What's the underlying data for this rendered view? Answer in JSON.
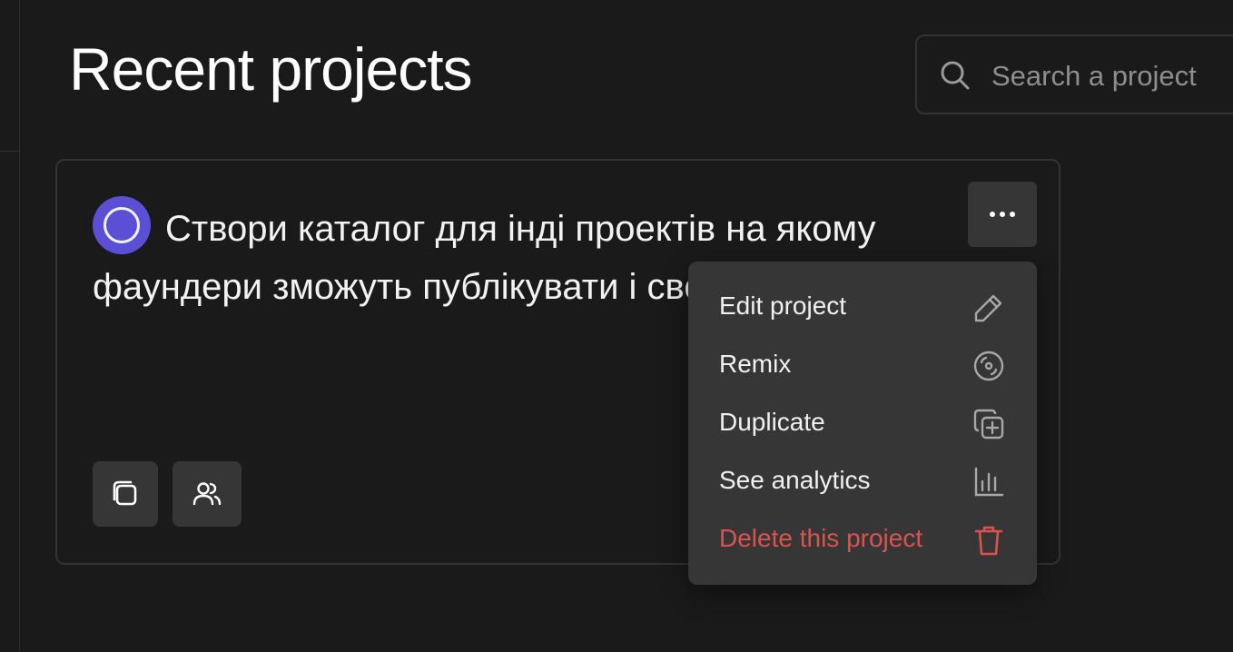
{
  "header": {
    "title": "Recent projects"
  },
  "search": {
    "placeholder": "Search a project",
    "value": "",
    "icon": "search-icon"
  },
  "project": {
    "avatar_color": "#5b4fd6",
    "description": "Створи каталог для інді проектів на якому фаундери зможуть публікувати і свої наробки...",
    "actions": [
      {
        "icon": "copy-icon"
      },
      {
        "icon": "users-icon"
      }
    ]
  },
  "menu": {
    "trigger_icon": "more-horizontal-icon",
    "items": [
      {
        "label": "Edit project",
        "icon": "pencil-icon"
      },
      {
        "label": "Remix",
        "icon": "remix-icon"
      },
      {
        "label": "Duplicate",
        "icon": "duplicate-icon"
      },
      {
        "label": "See analytics",
        "icon": "analytics-icon"
      },
      {
        "label": "Delete this project",
        "icon": "trash-icon",
        "color": "#d9534f"
      }
    ]
  },
  "colors": {
    "background": "#1a1a1a",
    "surface": "#363636",
    "border": "#333333",
    "danger": "#d9534f"
  }
}
